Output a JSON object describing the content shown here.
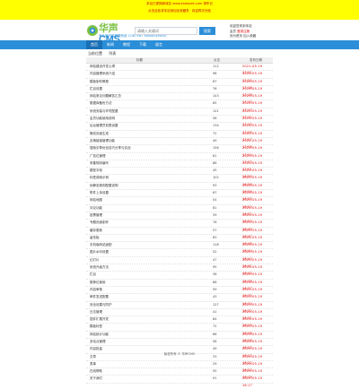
{
  "notice": {
    "line1": "本站已更换新域名 www.example.com 请牢记",
    "line2": "点击此处将本站添加至收藏夹 · 欢迎再次光临"
  },
  "header": {
    "logo_text_a": "华声",
    "logo_text_b": "CMS",
    "logo_slogan": "专业的内容管理系统 CONTENT MANAGEMENT",
    "search_placeholder": "请输入关键词",
    "search_button": "搜索",
    "user_line1": "欢迎您来到本站",
    "user_line2_a": "会员",
    "user_line2_b": "登录注册",
    "user_line3": "设为首页 加入收藏"
  },
  "nav": [
    "首页",
    "新闻",
    "教程",
    "下载",
    "留言"
  ],
  "nav_active_index": 0,
  "breadcrumb": [
    "当前位置",
    "列表"
  ],
  "list_header": {
    "title": "标题",
    "views": "点击",
    "date": "发布日期"
  },
  "rows": [
    {
      "title": "网站建设开发心得",
      "views": "112",
      "date": "2021-05-19 17:21"
    },
    {
      "title": "内容管理系统介绍",
      "views": "98",
      "date": "2021-05-19 17:20"
    },
    {
      "title": "模板制作教程",
      "views": "87",
      "date": "2021-05-19 17:18"
    },
    {
      "title": "栏目设置",
      "views": "76",
      "date": "2021-05-19 17:16"
    },
    {
      "title": "网站常见问题解答汇总",
      "views": "143",
      "date": "2021-05-19 17:15"
    },
    {
      "title": "数据库备份方法",
      "views": "65",
      "date": "2021-05-19 17:13"
    },
    {
      "title": "系统安装与环境配置",
      "views": "121",
      "date": "2021-05-19 17:12"
    },
    {
      "title": "会员功能使用说明",
      "views": "58",
      "date": "2021-05-19 17:10"
    },
    {
      "title": "后台管理员权限设置",
      "views": "134",
      "date": "2021-05-19 17:09"
    },
    {
      "title": "静态页面生成",
      "views": "72",
      "date": "2021-05-19 17:07"
    },
    {
      "title": "友情链接管理功能",
      "views": "49",
      "date": "2021-05-19 17:06"
    },
    {
      "title": "搜索引擎优化技巧分享与实战",
      "views": "156",
      "date": "2021-05-19 17:04"
    },
    {
      "title": "广告位管理",
      "views": "61",
      "date": "2021-05-19 17:03"
    },
    {
      "title": "采集规则编写",
      "views": "88",
      "date": "2021-05-19 17:01"
    },
    {
      "title": "模型字段",
      "views": "45",
      "date": "2021-05-19 16:59"
    },
    {
      "title": "标签调用示例",
      "views": "102",
      "date": "2021-05-19 16:58"
    },
    {
      "title": "伪静态规则配置说明",
      "views": "93",
      "date": "2021-05-19 16:56"
    },
    {
      "title": "附件上传设置",
      "views": "67",
      "date": "2021-05-19 16:55"
    },
    {
      "title": "网站地图",
      "views": "54",
      "date": "2021-05-19 16:53"
    },
    {
      "title": "评论功能",
      "views": "81",
      "date": "2021-05-19 16:52"
    },
    {
      "title": "投票管理",
      "views": "39",
      "date": "2021-05-19 16:50"
    },
    {
      "title": "专题页面制作",
      "views": "76",
      "date": "2021-05-19 16:49"
    },
    {
      "title": "缓存更新",
      "views": "57",
      "date": "2021-05-19 16:47"
    },
    {
      "title": "留言板",
      "views": "63",
      "date": "2021-05-19 16:46"
    },
    {
      "title": "手机版网站适配",
      "views": "118",
      "date": "2021-05-19 16:44"
    },
    {
      "title": "图片水印设置",
      "views": "52",
      "date": "2021-05-19 16:43"
    },
    {
      "title": "幻灯片",
      "views": "47",
      "date": "2021-05-19 16:41"
    },
    {
      "title": "系统升级方法",
      "views": "95",
      "date": "2021-05-19 16:40"
    },
    {
      "title": "栏目",
      "views": "36",
      "date": "2021-05-19 16:38"
    },
    {
      "title": "推荐位使用",
      "views": "68",
      "date": "2021-05-19 16:37"
    },
    {
      "title": "内容审核",
      "views": "59",
      "date": "2021-05-19 16:35"
    },
    {
      "title": "邮件发送配置",
      "views": "43",
      "date": "2021-05-19 16:34"
    },
    {
      "title": "安全设置与防护",
      "views": "127",
      "date": "2021-05-19 16:32"
    },
    {
      "title": "日志管理",
      "views": "41",
      "date": "2021-05-19 16:31"
    },
    {
      "title": "插件扩展开发",
      "views": "84",
      "date": "2021-05-19 16:29"
    },
    {
      "title": "模板标签",
      "views": "72",
      "date": "2021-05-19 16:28"
    },
    {
      "title": "网站统计功能",
      "views": "66",
      "date": "2021-05-19 16:26"
    },
    {
      "title": "多站点管理",
      "views": "58",
      "date": "2021-05-19 16:25"
    },
    {
      "title": "内容批量",
      "views": "49",
      "date": "2021-05-19 16:23"
    },
    {
      "title": "文章",
      "views": "33",
      "date": "2021-05-19 16:22"
    },
    {
      "title": "表单",
      "views": "29",
      "date": "2021-05-19 16:20"
    },
    {
      "title": "在线帮助",
      "views": "55",
      "date": "2021-05-19 16:19"
    },
    {
      "title": "关于我们",
      "views": "91",
      "date": "2021-05-19 16:17"
    }
  ],
  "footer": "版权所有 © 华声CMS"
}
